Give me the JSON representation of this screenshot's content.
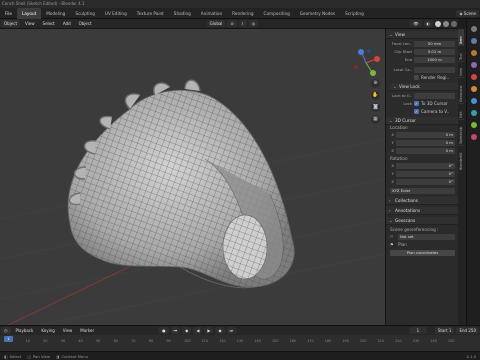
{
  "title": "Conch Shell (Sketch Edited) - Blender 4.1",
  "workspaces": [
    "Layout",
    "Modeling",
    "Sculpting",
    "UV Editing",
    "Texture Paint",
    "Shading",
    "Animation",
    "Rendering",
    "Compositing",
    "Geometry Nodes",
    "Scripting"
  ],
  "active_workspace": "Layout",
  "scene_name": "Scene",
  "header": {
    "mode": "Object",
    "view": "View",
    "select": "Select",
    "add": "Add",
    "object": "Object",
    "orientation": "Global",
    "options": "Options"
  },
  "npanel": {
    "view_section": "View",
    "focal_length_label": "Focal Len..",
    "focal_length_value": "50 mm",
    "clip_start_label": "Clip Start",
    "clip_start_value": "0.01 m",
    "clip_end_label": "End",
    "clip_end_value": "1000 m",
    "local_camera_label": "Local Ca..",
    "render_region_label": "Render Regi..",
    "view_lock_section": "View Lock",
    "lock_to_object_label": "Lock to O..",
    "lock_label": "Lock",
    "to_3d_cursor_label": "To 3D Cursor",
    "camera_to_view_label": "Camera to V..",
    "cursor_section": "3D Cursor",
    "location_label": "Location",
    "x_label": "X",
    "y_label": "Y",
    "z_label": "Z",
    "loc_x": "0 m",
    "loc_y": "0 m",
    "loc_z": "0 m",
    "rotation_label": "Rotation",
    "rot_x": "0°",
    "rot_y": "0°",
    "rot_z": "0°",
    "rotation_mode": "XYZ Euler",
    "collections_section": "Collections",
    "annotations_section": "Annotations",
    "geoscans_section": "Geoscans",
    "georef_label": "Scene georeferencing :",
    "not_set_label": "Not set",
    "plan_label": "Plan",
    "plan_coords_button": "Plan coordinates"
  },
  "side_tabs": [
    "Item",
    "Tool",
    "View",
    "Geoscans",
    "Edit",
    "Sketchfab",
    "BlenderKit"
  ],
  "right_tabs": [
    "Tool",
    "View",
    "Item",
    "Scene",
    "World"
  ],
  "timeline": {
    "playback": "Playback",
    "keying": "Keying",
    "view": "View",
    "marker": "Marker",
    "current_frame": "1",
    "start_label": "Start",
    "start_value": "1",
    "end_label": "End",
    "end_value": "250"
  },
  "ruler_ticks": [
    "0",
    "10",
    "20",
    "30",
    "40",
    "50",
    "60",
    "70",
    "80",
    "90",
    "100",
    "110",
    "120",
    "130",
    "140",
    "150",
    "160",
    "170",
    "180",
    "190",
    "200",
    "210",
    "220",
    "230",
    "240",
    "250"
  ],
  "status": {
    "left": "Select",
    "middle": "Pan View",
    "right": "Context Menu",
    "version": "4.1.0"
  },
  "colors": {
    "accent": "#4772b3",
    "viewport": "#3b3b3b",
    "mesh": "#b9b9b9",
    "axis_x": "#d4453b",
    "axis_y": "#80b53a",
    "axis_z": "#4a7fd4"
  },
  "icons": [
    "search-icon",
    "hand-pan-icon",
    "zoom-icon",
    "camera-icon",
    "grid-icon",
    "eye-icon",
    "play-icon",
    "gear-icon"
  ]
}
